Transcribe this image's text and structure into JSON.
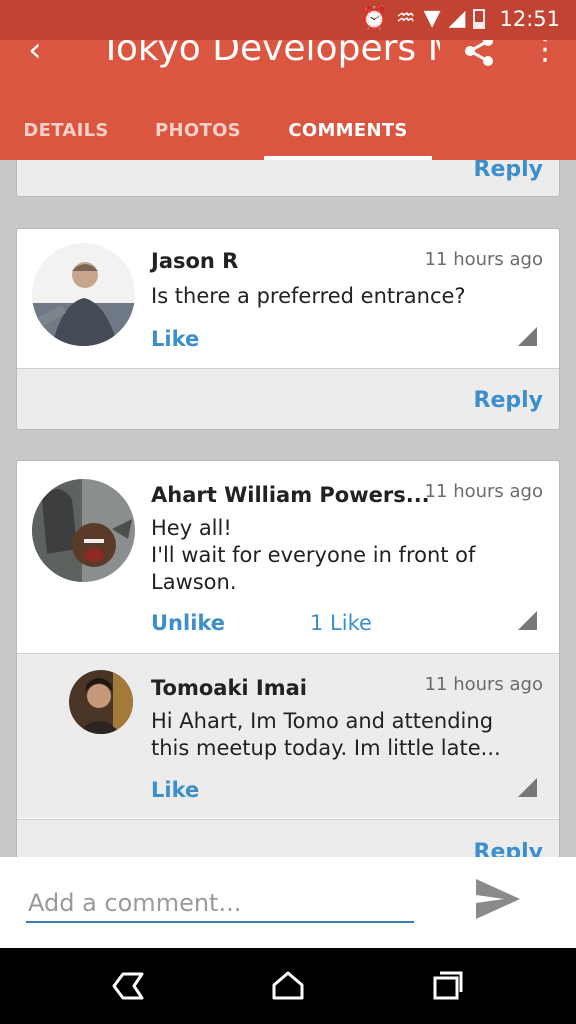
{
  "status_bar": {
    "time": "12:51",
    "icons": [
      "alarm-icon",
      "vibrate-icon",
      "wifi-icon",
      "signal-icon",
      "battery-icon"
    ]
  },
  "app_bar": {
    "title": "Tokyo Developers M...",
    "colors": {
      "primary": "#db5640",
      "status": "#c24331"
    }
  },
  "tabs": [
    {
      "label": "DETAILS",
      "active": false
    },
    {
      "label": "PHOTOS",
      "active": false
    },
    {
      "label": "COMMENTS",
      "active": true
    }
  ],
  "comments": {
    "reply_label": "Reply",
    "items": [
      {
        "name": "Jason R",
        "time": "11 hours ago",
        "text": "Is there a preferred entrance?",
        "like_label": "Like"
      },
      {
        "name": "Ahart William Powers...",
        "time": "11 hours ago",
        "text": "Hey all!\nI'll wait for everyone in front of Lawson.",
        "like_label": "Unlike",
        "like_count": "1 Like",
        "replies": [
          {
            "name": "Tomoaki Imai",
            "time": "11 hours ago",
            "text": "Hi Ahart, Im Tomo and attending this meetup today. Im little late...",
            "like_label": "Like"
          }
        ]
      }
    ]
  },
  "composer": {
    "placeholder": "Add a comment..."
  }
}
